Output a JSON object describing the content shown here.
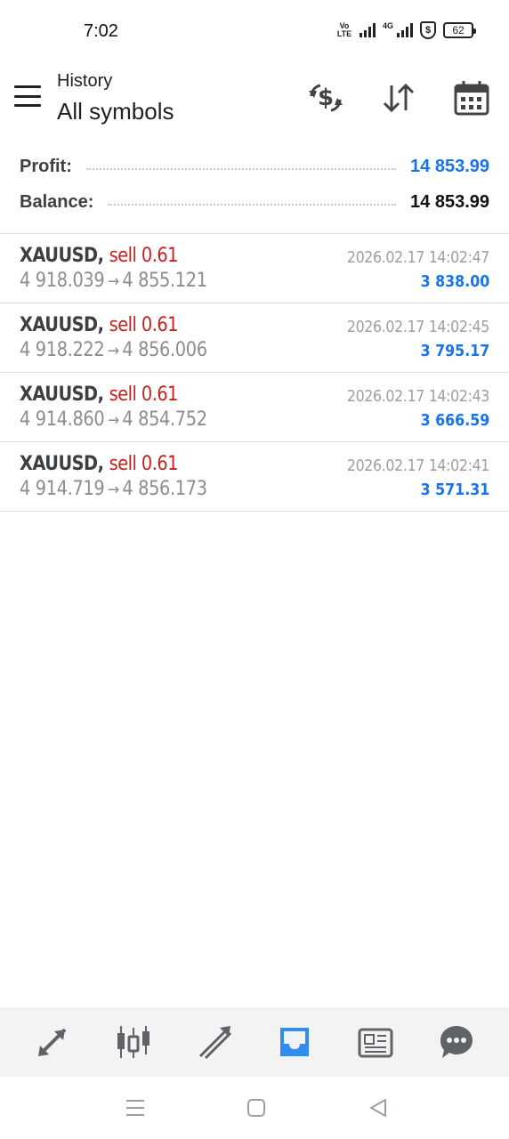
{
  "status_bar": {
    "time": "7:02",
    "volte_top": "Vo",
    "volte_bottom": "LTE",
    "network": "4G",
    "shield_symbol": "$",
    "battery": "62"
  },
  "header": {
    "subtitle": "History",
    "title": "All symbols",
    "icons": [
      "menu-icon",
      "dollar-exchange-icon",
      "sort-arrows-icon",
      "calendar-icon"
    ]
  },
  "summary": {
    "profit_label": "Profit:",
    "profit_value": "14 853.99",
    "balance_label": "Balance:",
    "balance_value": "14 853.99"
  },
  "deals": [
    {
      "symbol": "XAUUSD,",
      "type": "sell 0.61",
      "open": "4 918.039",
      "arrow": "→",
      "close": "4 855.121",
      "time": "2026.02.17 14:02:47",
      "profit": "3 838.00"
    },
    {
      "symbol": "XAUUSD,",
      "type": "sell 0.61",
      "open": "4 918.222",
      "arrow": "→",
      "close": "4 856.006",
      "time": "2026.02.17 14:02:45",
      "profit": "3 795.17"
    },
    {
      "symbol": "XAUUSD,",
      "type": "sell 0.61",
      "open": "4 914.860",
      "arrow": "→",
      "close": "4 854.752",
      "time": "2026.02.17 14:02:43",
      "profit": "3 666.59"
    },
    {
      "symbol": "XAUUSD,",
      "type": "sell 0.61",
      "open": "4 914.719",
      "arrow": "→",
      "close": "4 856.173",
      "time": "2026.02.17 14:02:41",
      "profit": "3 571.31"
    }
  ],
  "tabbar": {
    "tabs": [
      "quotes-icon",
      "chart-candles-icon",
      "trade-icon",
      "history-inbox-icon",
      "news-icon",
      "chat-icon"
    ],
    "active_tab": "history-inbox-icon"
  },
  "system_nav": {
    "icons": [
      "recents-icon",
      "home-icon",
      "back-icon"
    ]
  },
  "colors": {
    "accent_blue": "#1a73e8",
    "sell_red": "#c5221f",
    "tab_active": "#2f8cf0",
    "tab_inactive": "#5f6368"
  }
}
